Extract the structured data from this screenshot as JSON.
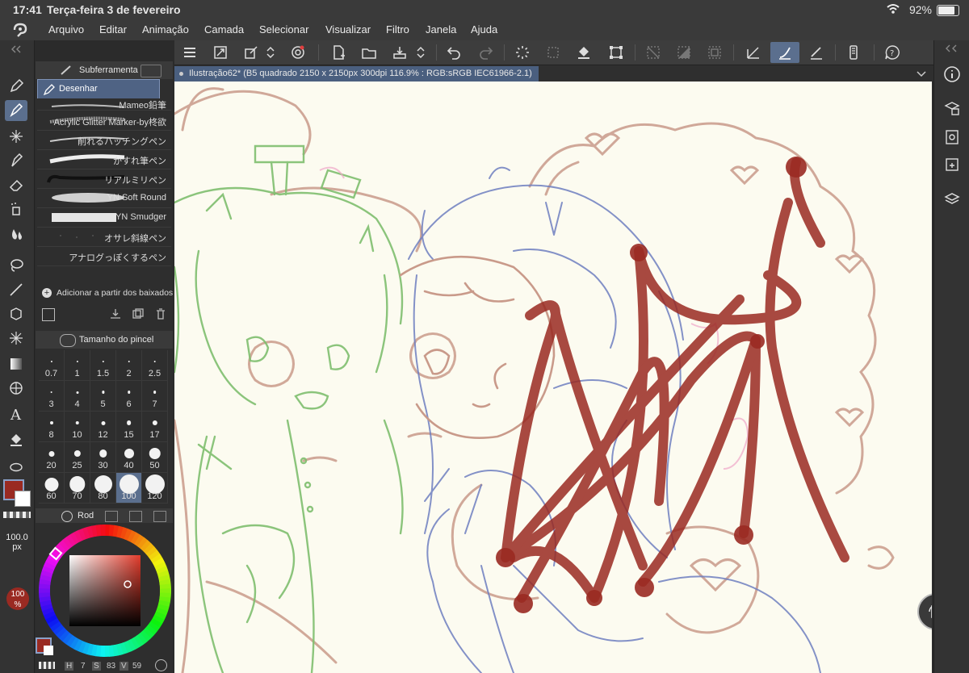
{
  "status_bar": {
    "time": "17:41",
    "date": "Terça-feira 3 de fevereiro",
    "battery": "92%"
  },
  "menu": {
    "items": [
      "Arquivo",
      "Editar",
      "Animação",
      "Camada",
      "Selecionar",
      "Visualizar",
      "Filtro",
      "Janela",
      "Ajuda"
    ]
  },
  "subtool_panel": {
    "title": "Subferramenta",
    "selected": "Desenhar",
    "brushes": [
      "Mameo鉛筆",
      "Acrylic Glitter Marker-by柊欲",
      "削れるハッチングペン",
      "かすれ筆ペン",
      "リアルミリペン",
      "YN Soft Round",
      "YN Smudger",
      "オサレ斜線ペン",
      "アナログっぽくするペン"
    ],
    "add_label": "Adicionar a partir dos baixados"
  },
  "brush_size_panel": {
    "title": "Tamanho do pincel",
    "sizes": [
      "0.7",
      "1",
      "1.5",
      "2",
      "2.5",
      "3",
      "4",
      "5",
      "6",
      "7",
      "8",
      "10",
      "12",
      "15",
      "17",
      "20",
      "25",
      "30",
      "40",
      "50",
      "60",
      "70",
      "80",
      "100",
      "120"
    ],
    "selected": "100"
  },
  "color_panel": {
    "tab_label": "Rod",
    "size_value": "100.0",
    "size_unit": "px",
    "opacity_value": "100",
    "opacity_unit": "%",
    "h_label": "H",
    "h_value": "7",
    "s_label": "S",
    "s_value": "83",
    "v_label": "V",
    "v_value": "59",
    "main_color": "#9a2a22",
    "sub_color": "#ffffff"
  },
  "document": {
    "tab": "Ilustração62* (B5 quadrado 2150 x 2150px 300dpi 116.9% : RGB:sRGB IEC61966-2.1)"
  },
  "colors": {
    "accent": "#5b6f8e",
    "canvas_bg": "#fcfbf0",
    "sketch_green": "#7fbf6f",
    "sketch_blue": "#6f7fc0",
    "sketch_brown": "#c99a8a",
    "scribble_red": "#9a2a22"
  }
}
